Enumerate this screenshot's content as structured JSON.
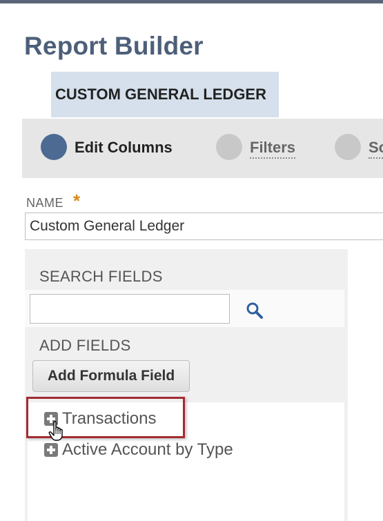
{
  "header": {
    "title": "Report Builder",
    "subtitle": "CUSTOM GENERAL LEDGER"
  },
  "steps": [
    {
      "label": "Edit Columns",
      "state": "active"
    },
    {
      "label": "Filters",
      "state": "inactive"
    },
    {
      "label": "So",
      "state": "inactive"
    }
  ],
  "name_field": {
    "label": "NAME",
    "required_marker": "*",
    "value": "Custom General Ledger"
  },
  "fields_panel": {
    "search_label": "SEARCH FIELDS",
    "search_value": "",
    "add_fields_label": "ADD FIELDS",
    "formula_button": "Add Formula Field",
    "tree_items": [
      {
        "label": "Transactions",
        "icon": "plus-expand-icon"
      },
      {
        "label": "Active Account by Type",
        "icon": "plus-expand-icon"
      }
    ]
  },
  "colors": {
    "title": "#4d5f79",
    "subtitle_bg": "#d5e0ec",
    "active_step": "#4d6a93",
    "inactive_step": "#c8c8c8",
    "required_star": "#d68a1c",
    "highlight_border": "#a32b32"
  },
  "icons": {
    "search": "magnifier-icon",
    "cursor": "hand-pointer-icon"
  }
}
